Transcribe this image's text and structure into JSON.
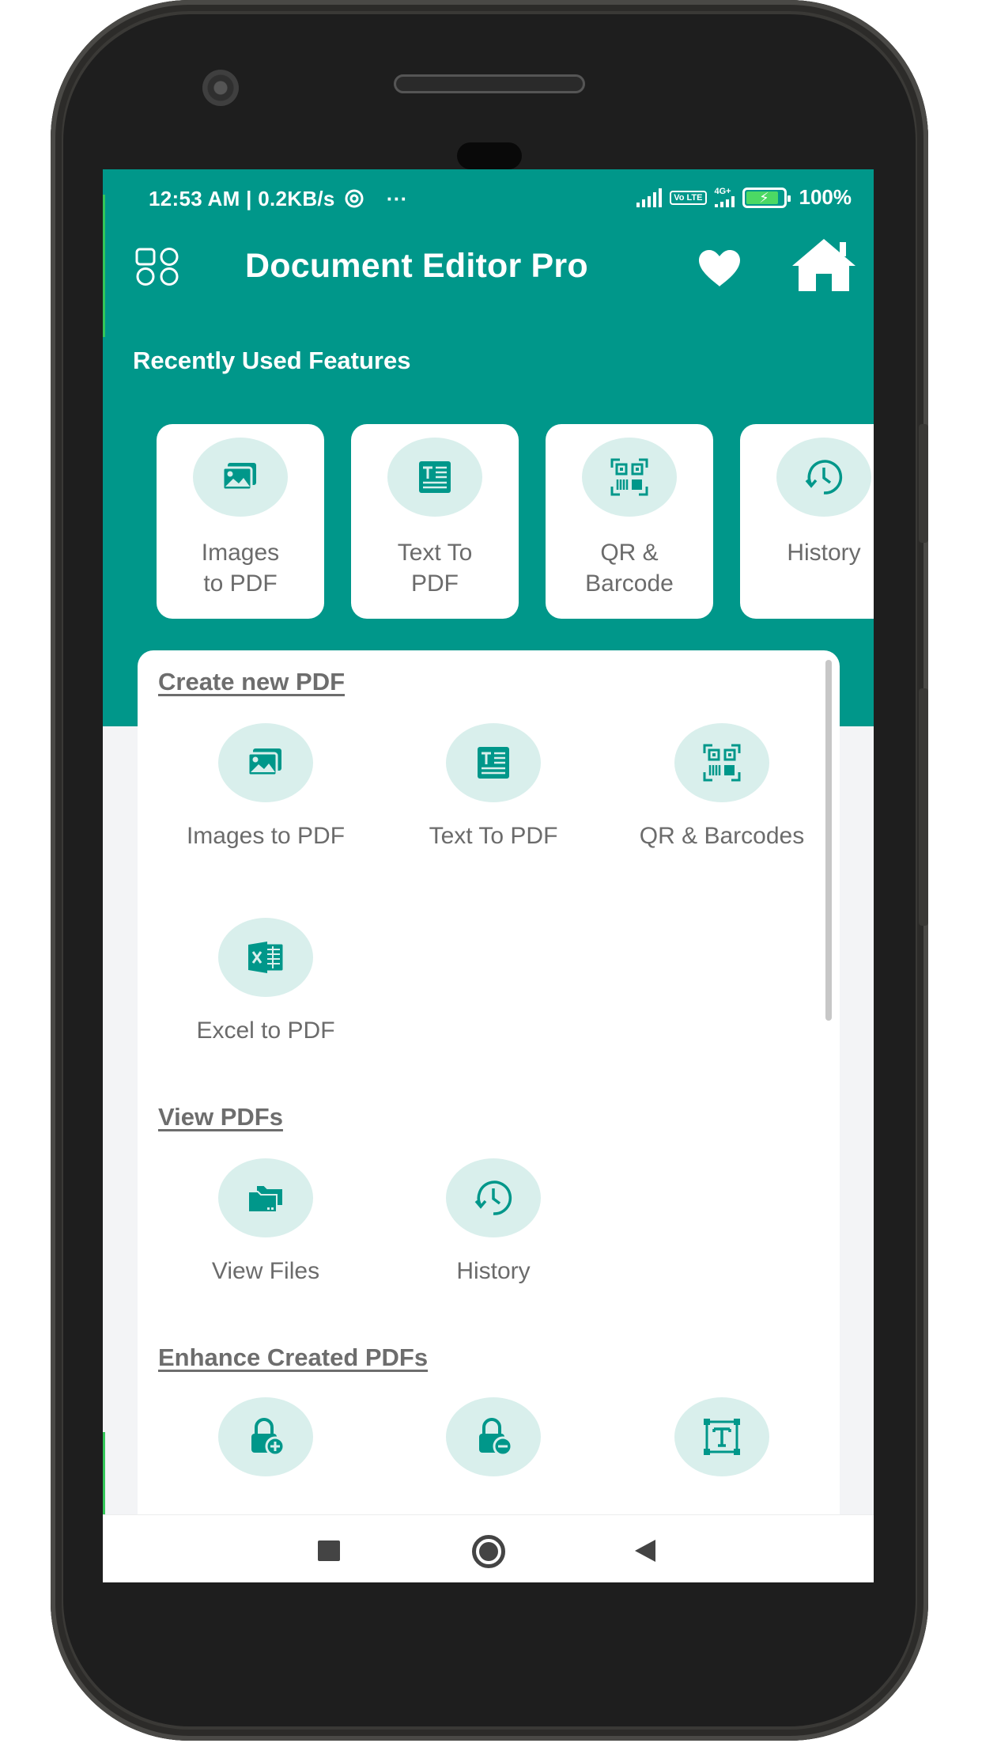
{
  "status_bar": {
    "time": "12:53 AM | 0.2KB/s",
    "more": "···",
    "volte": "Vo LTE",
    "network": "4G+",
    "battery": "100%"
  },
  "app_bar": {
    "title": "Document Editor Pro"
  },
  "recent": {
    "title": "Recently Used Features",
    "items": [
      {
        "label": "Images\nto PDF",
        "icon": "image-icon"
      },
      {
        "label": "Text To\nPDF",
        "icon": "text-doc-icon"
      },
      {
        "label": "QR &\nBarcode",
        "icon": "qr-code-icon"
      },
      {
        "label": "History",
        "icon": "history-icon"
      }
    ]
  },
  "create": {
    "title": "Create new PDF",
    "items": [
      {
        "label": "Images to PDF",
        "icon": "image-icon"
      },
      {
        "label": "Text To PDF",
        "icon": "text-doc-icon"
      },
      {
        "label": "QR & Barcodes",
        "icon": "qr-code-icon"
      },
      {
        "label": "Excel to PDF",
        "icon": "excel-icon"
      }
    ]
  },
  "view": {
    "title": "View PDFs",
    "items": [
      {
        "label": "View Files",
        "icon": "folders-icon"
      },
      {
        "label": "History",
        "icon": "history-icon"
      }
    ]
  },
  "enhance": {
    "title": "Enhance Created PDFs",
    "items": [
      {
        "icon": "lock-add-icon"
      },
      {
        "icon": "lock-remove-icon"
      },
      {
        "icon": "text-frame-icon"
      }
    ]
  },
  "colors": {
    "primary": "#00978a",
    "icon_bg": "#d9efec",
    "label": "#6b6b6b"
  }
}
